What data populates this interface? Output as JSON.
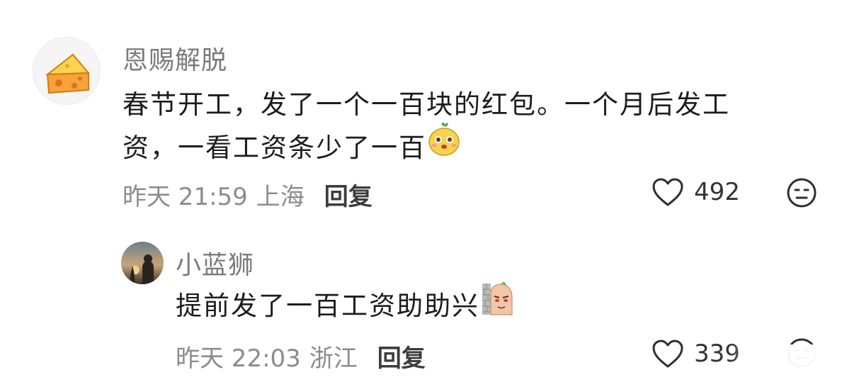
{
  "comments": [
    {
      "username": "恩赐解脱",
      "avatar_icon": "cheese-icon",
      "text_line1": "春节开工，发了一个一百块的红包。一个月后发工",
      "text_line2": "资，一看工资条少了一百",
      "emoji": "smiling-mascot-emoji",
      "time": "昨天 21:59",
      "location": "上海",
      "reply_label": "回复",
      "likes": "492"
    },
    {
      "username": "小蓝狮",
      "avatar_icon": "sunset-silhouette-avatar",
      "text": "提前发了一百工资助助兴",
      "emoji": "peeking-wall-emoji",
      "time": "昨天 22:03",
      "location": "浙江",
      "reply_label": "回复",
      "likes": "339"
    }
  ],
  "colors": {
    "username": "#7b7b7b",
    "meta": "#8c8c8c",
    "text": "#1c1c1c",
    "cheese": "#f7a23a"
  }
}
